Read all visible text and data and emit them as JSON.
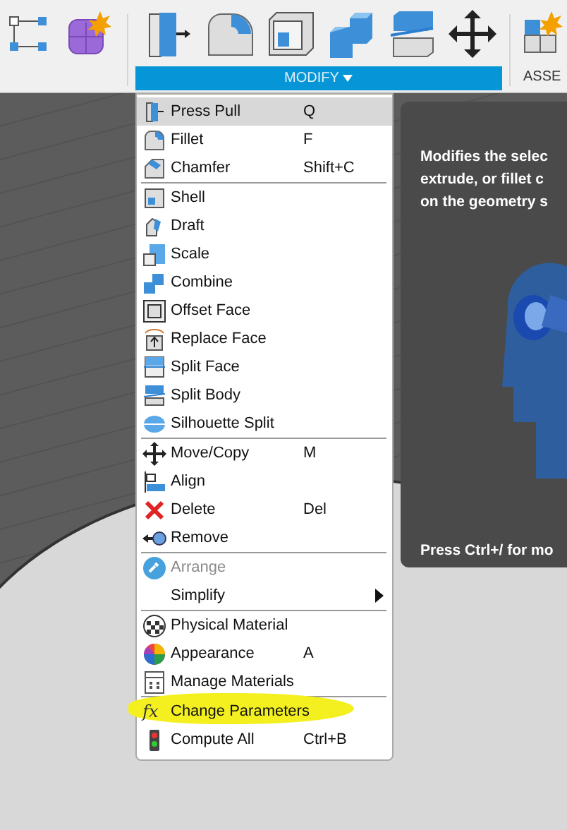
{
  "toolbar": {
    "groups": [
      {
        "label": "MODIFY",
        "active": true
      },
      {
        "label": "ASSE",
        "active": false
      }
    ]
  },
  "menu": {
    "groups": [
      [
        {
          "label": "Press Pull",
          "shortcut": "Q",
          "selected": true,
          "disabled": false,
          "submenu": false,
          "annotated": false
        },
        {
          "label": "Fillet",
          "shortcut": "F",
          "selected": false,
          "disabled": false,
          "submenu": false,
          "annotated": false
        },
        {
          "label": "Chamfer",
          "shortcut": "Shift+C",
          "selected": false,
          "disabled": false,
          "submenu": false,
          "annotated": false
        }
      ],
      [
        {
          "label": "Shell",
          "selected": false,
          "disabled": false,
          "submenu": false,
          "annotated": false
        },
        {
          "label": "Draft",
          "selected": false,
          "disabled": false,
          "submenu": false,
          "annotated": false
        },
        {
          "label": "Scale",
          "selected": false,
          "disabled": false,
          "submenu": false,
          "annotated": false
        },
        {
          "label": "Combine",
          "selected": false,
          "disabled": false,
          "submenu": false,
          "annotated": false
        },
        {
          "label": "Offset Face",
          "selected": false,
          "disabled": false,
          "submenu": false,
          "annotated": false
        },
        {
          "label": "Replace Face",
          "selected": false,
          "disabled": false,
          "submenu": false,
          "annotated": false
        },
        {
          "label": "Split Face",
          "selected": false,
          "disabled": false,
          "submenu": false,
          "annotated": false
        },
        {
          "label": "Split Body",
          "selected": false,
          "disabled": false,
          "submenu": false,
          "annotated": false
        },
        {
          "label": "Silhouette Split",
          "selected": false,
          "disabled": false,
          "submenu": false,
          "annotated": false
        }
      ],
      [
        {
          "label": "Move/Copy",
          "shortcut": "M",
          "selected": false,
          "disabled": false,
          "submenu": false,
          "annotated": false
        },
        {
          "label": "Align",
          "selected": false,
          "disabled": false,
          "submenu": false,
          "annotated": false
        },
        {
          "label": "Delete",
          "shortcut": "Del",
          "selected": false,
          "disabled": false,
          "submenu": false,
          "annotated": false
        },
        {
          "label": "Remove",
          "selected": false,
          "disabled": false,
          "submenu": false,
          "annotated": false
        }
      ],
      [
        {
          "label": "Arrange",
          "selected": false,
          "disabled": true,
          "submenu": false,
          "annotated": false
        },
        {
          "label": "Simplify",
          "selected": false,
          "disabled": false,
          "submenu": true,
          "annotated": false
        }
      ],
      [
        {
          "label": "Physical Material",
          "selected": false,
          "disabled": false,
          "submenu": false,
          "annotated": false
        },
        {
          "label": "Appearance",
          "shortcut": "A",
          "selected": false,
          "disabled": false,
          "submenu": false,
          "annotated": false
        },
        {
          "label": "Manage Materials",
          "selected": false,
          "disabled": false,
          "submenu": false,
          "annotated": false
        }
      ],
      [
        {
          "label": "Change Parameters",
          "icon_text": "fx",
          "selected": false,
          "disabled": false,
          "submenu": false,
          "annotated": true
        },
        {
          "label": "Compute All",
          "shortcut": "Ctrl+B",
          "selected": false,
          "disabled": false,
          "submenu": false,
          "annotated": false
        }
      ]
    ]
  },
  "tooltip": {
    "description_lines": [
      "Modifies the selec",
      "extrude, or fillet c",
      "on the geometry s"
    ],
    "hint": "Press Ctrl+/ for mo"
  }
}
